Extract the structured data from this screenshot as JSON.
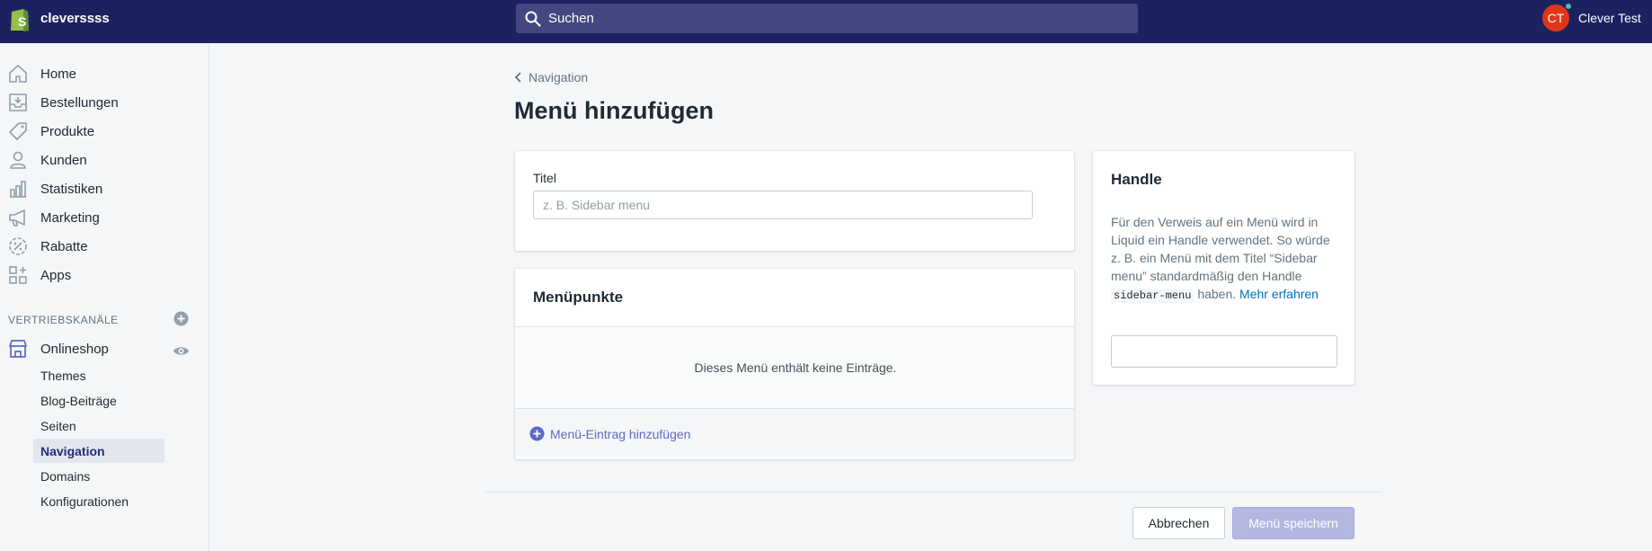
{
  "topbar": {
    "store_name": "cleverssss",
    "search_placeholder": "Suchen",
    "avatar_initials": "CT",
    "user_name": "Clever Test"
  },
  "sidebar": {
    "items": [
      {
        "label": "Home",
        "icon": "home-icon"
      },
      {
        "label": "Bestellungen",
        "icon": "orders-icon"
      },
      {
        "label": "Produkte",
        "icon": "tag-icon"
      },
      {
        "label": "Kunden",
        "icon": "customer-icon"
      },
      {
        "label": "Statistiken",
        "icon": "analytics-icon"
      },
      {
        "label": "Marketing",
        "icon": "megaphone-icon"
      },
      {
        "label": "Rabatte",
        "icon": "discount-icon"
      },
      {
        "label": "Apps",
        "icon": "apps-icon"
      }
    ],
    "section_title": "VERTRIEBSKANÄLE",
    "channel": {
      "label": "Onlineshop",
      "icon": "store-icon"
    },
    "sub_items": [
      {
        "label": "Themes"
      },
      {
        "label": "Blog-Beiträge"
      },
      {
        "label": "Seiten"
      },
      {
        "label": "Navigation"
      },
      {
        "label": "Domains"
      },
      {
        "label": "Konfigurationen"
      }
    ],
    "active_sub_item": "Navigation"
  },
  "main": {
    "back_label": "Navigation",
    "page_title": "Menü hinzufügen",
    "title_card": {
      "label": "Titel",
      "placeholder": "z. B. Sidebar menu",
      "value": ""
    },
    "menu_items_card": {
      "title": "Menüpunkte",
      "empty_text": "Dieses Menü enthält keine Einträge.",
      "add_label": "Menü-Eintrag hinzufügen"
    },
    "handle_card": {
      "title": "Handle",
      "desc_part1": "Für den Verweis auf ein Menü wird in Liquid ein Handle verwendet. So würde z. B. ein Menü mit dem Titel “Sidebar menu” standardmäßig den Handle",
      "code": "sidebar-menu",
      "desc_part2": "haben.",
      "more_link": "Mehr erfahren",
      "value": ""
    },
    "actions": {
      "cancel_label": "Abbrechen",
      "save_label": "Menü speichern"
    }
  },
  "colors": {
    "topbar": "#1c2260",
    "accent": "#5c6ac4",
    "link": "#006fbb",
    "save_disabled": "#b3b7e1"
  }
}
